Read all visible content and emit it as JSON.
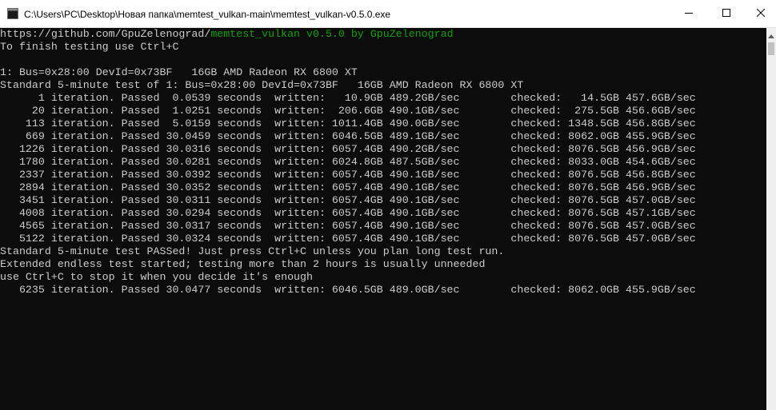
{
  "window": {
    "title": "C:\\Users\\PC\\Desktop\\Новая папка\\memtest_vulkan-main\\memtest_vulkan-v0.5.0.exe"
  },
  "console": {
    "url_line": "https://github.com/GpuZelenograd/",
    "app_banner": "memtest_vulkan v0.5.0 by GpuZelenograd",
    "lines": [
      "To finish testing use Ctrl+C",
      "",
      "1: Bus=0x28:00 DevId=0x73BF   16GB AMD Radeon RX 6800 XT",
      "Standard 5-minute test of 1: Bus=0x28:00 DevId=0x73BF   16GB AMD Radeon RX 6800 XT",
      "      1 iteration. Passed  0.0539 seconds  written:   10.9GB 489.2GB/sec        checked:   14.5GB 457.6GB/sec",
      "     20 iteration. Passed  1.0251 seconds  written:  206.6GB 490.1GB/sec        checked:  275.5GB 456.6GB/sec",
      "    113 iteration. Passed  5.0159 seconds  written: 1011.4GB 490.0GB/sec        checked: 1348.5GB 456.8GB/sec",
      "    669 iteration. Passed 30.0459 seconds  written: 6046.5GB 489.1GB/sec        checked: 8062.0GB 455.9GB/sec",
      "   1226 iteration. Passed 30.0316 seconds  written: 6057.4GB 490.2GB/sec        checked: 8076.5GB 456.9GB/sec",
      "   1780 iteration. Passed 30.0281 seconds  written: 6024.8GB 487.5GB/sec        checked: 8033.0GB 454.6GB/sec",
      "   2337 iteration. Passed 30.0392 seconds  written: 6057.4GB 490.1GB/sec        checked: 8076.5GB 456.8GB/sec",
      "   2894 iteration. Passed 30.0352 seconds  written: 6057.4GB 490.1GB/sec        checked: 8076.5GB 456.9GB/sec",
      "   3451 iteration. Passed 30.0311 seconds  written: 6057.4GB 490.1GB/sec        checked: 8076.5GB 457.0GB/sec",
      "   4008 iteration. Passed 30.0294 seconds  written: 6057.4GB 490.1GB/sec        checked: 8076.5GB 457.1GB/sec",
      "   4565 iteration. Passed 30.0317 seconds  written: 6057.4GB 490.1GB/sec        checked: 8076.5GB 457.0GB/sec",
      "   5122 iteration. Passed 30.0324 seconds  written: 6057.4GB 490.1GB/sec        checked: 8076.5GB 457.0GB/sec",
      "Standard 5-minute test PASSed! Just press Ctrl+C unless you plan long test run.",
      "Extended endless test started; testing more than 2 hours is usually unneeded",
      "use Ctrl+C to stop it when you decide it's enough",
      "   6235 iteration. Passed 30.0477 seconds  written: 6046.5GB 489.0GB/sec        checked: 8062.0GB 455.9GB/sec"
    ]
  },
  "colors": {
    "console_bg": "#0c0c0c",
    "console_text": "#cccccc",
    "banner_green": "#13a10e"
  },
  "icons": {
    "app": "console-app-icon",
    "minimize": "minimize-icon",
    "maximize": "maximize-icon",
    "close": "close-icon",
    "scroll_up": "scroll-up-arrow-icon"
  }
}
